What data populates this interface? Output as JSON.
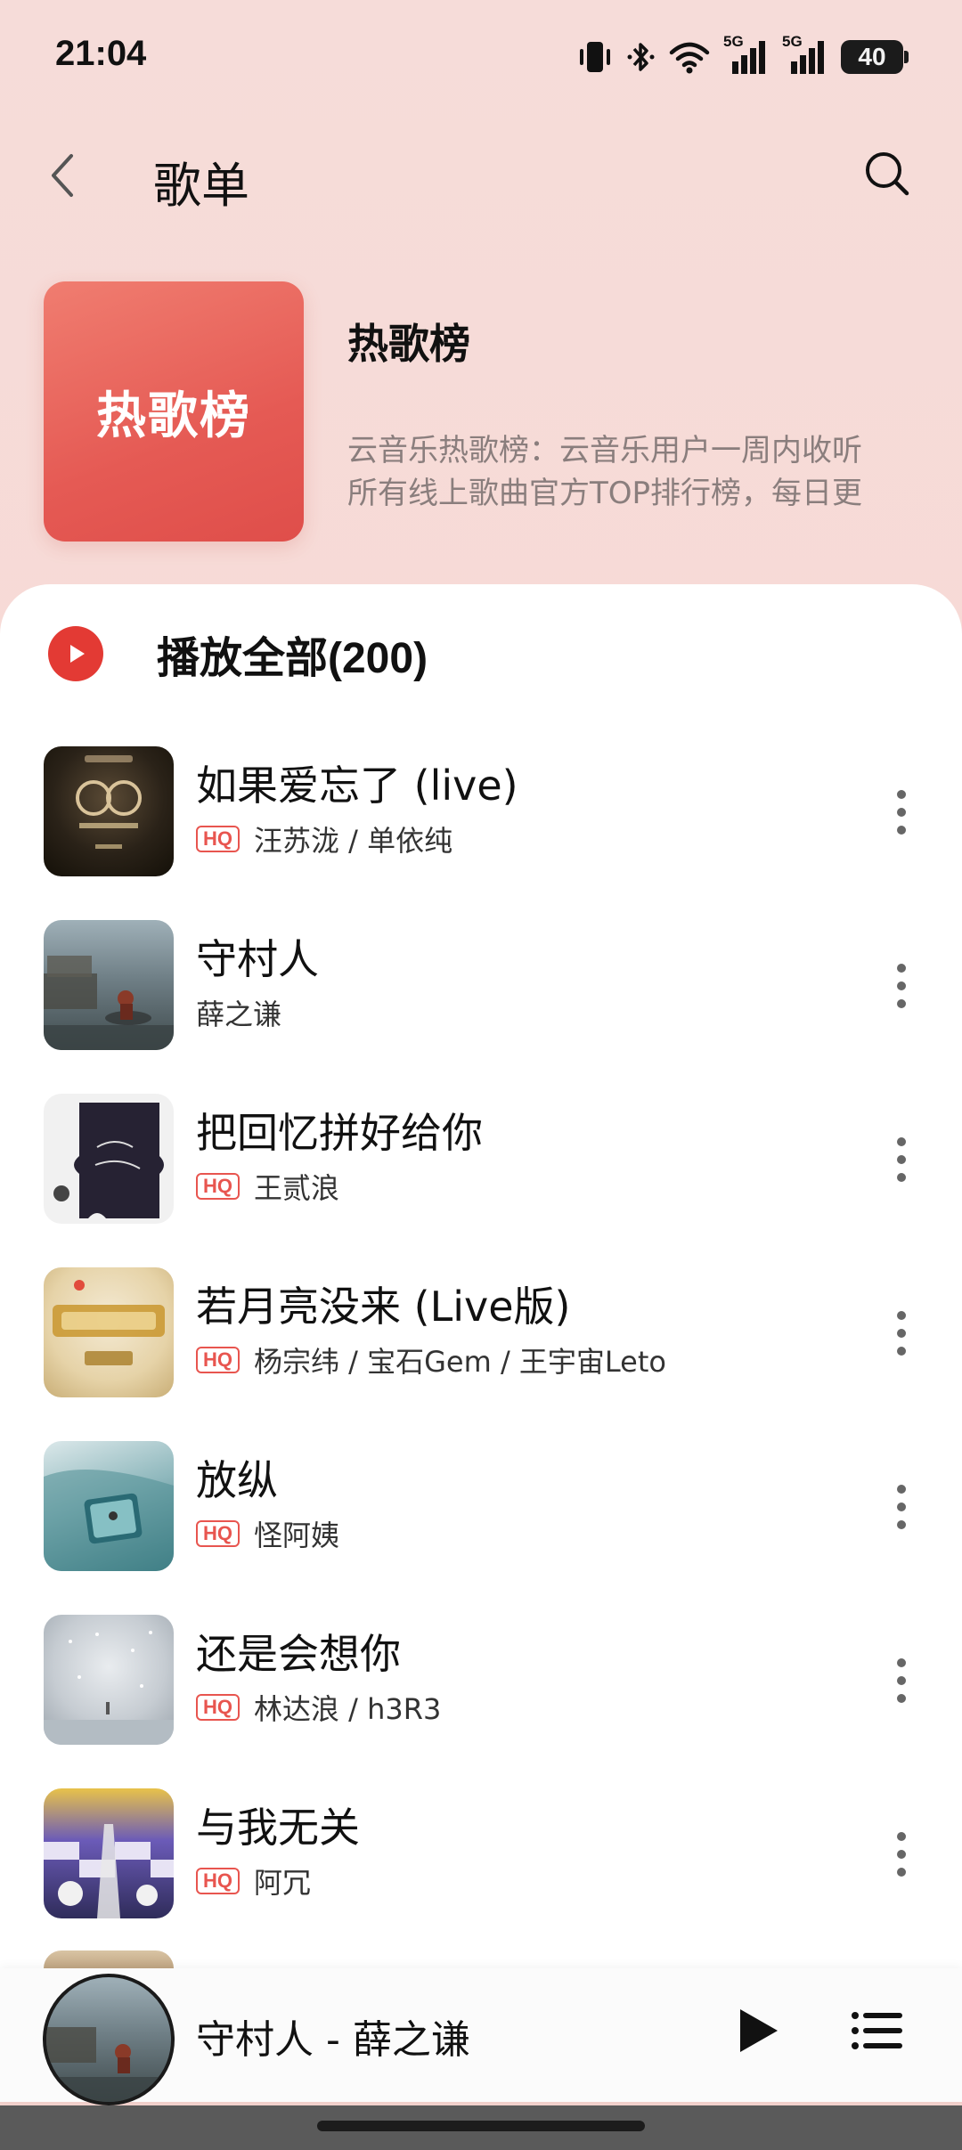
{
  "status_bar": {
    "time": "21:04",
    "battery": "40",
    "network_1": "5G",
    "network_2": "5G",
    "icons": [
      "vibrate-icon",
      "bluetooth-icon",
      "wifi-icon",
      "signal-icon",
      "signal-icon",
      "battery-icon"
    ]
  },
  "header": {
    "title": "歌单",
    "back_icon": "chevron-left-icon",
    "search_icon": "search-icon"
  },
  "playlist": {
    "cover_text": "热歌榜",
    "title": "热歌榜",
    "description": "云音乐热歌榜：云音乐用户一周内收听所有线上歌曲官方TOP排行榜，每日更新。",
    "description_line1": "云音乐热歌榜：云音乐用户一周内收听",
    "description_line2": "所有线上歌曲官方TOP排行榜，每日更"
  },
  "play_all": {
    "label": "播放全部(200)"
  },
  "songs": [
    {
      "title": "如果爱忘了 (live)",
      "hq": true,
      "artists": "汪苏泷 / 单依纯"
    },
    {
      "title": "守村人",
      "hq": false,
      "artists": "薛之谦"
    },
    {
      "title": "把回忆拼好给你",
      "hq": true,
      "artists": "王贰浪"
    },
    {
      "title": "若月亮没来 (Live版)",
      "hq": true,
      "artists": "杨宗纬 / 宝石Gem / 王宇宙Leto"
    },
    {
      "title": "放纵",
      "hq": true,
      "artists": "怪阿姨"
    },
    {
      "title": "还是会想你",
      "hq": true,
      "artists": "林达浪 / h3R3"
    },
    {
      "title": "与我无关",
      "hq": true,
      "artists": "阿冗"
    }
  ],
  "hq_label": "HQ",
  "mini_player": {
    "now_playing": "守村人 - 薛之谦"
  },
  "colors": {
    "accent": "#e33a34",
    "hq": "#e8554f",
    "cover_gradient_start": "#f07d70",
    "cover_gradient_end": "#df4e4a"
  }
}
